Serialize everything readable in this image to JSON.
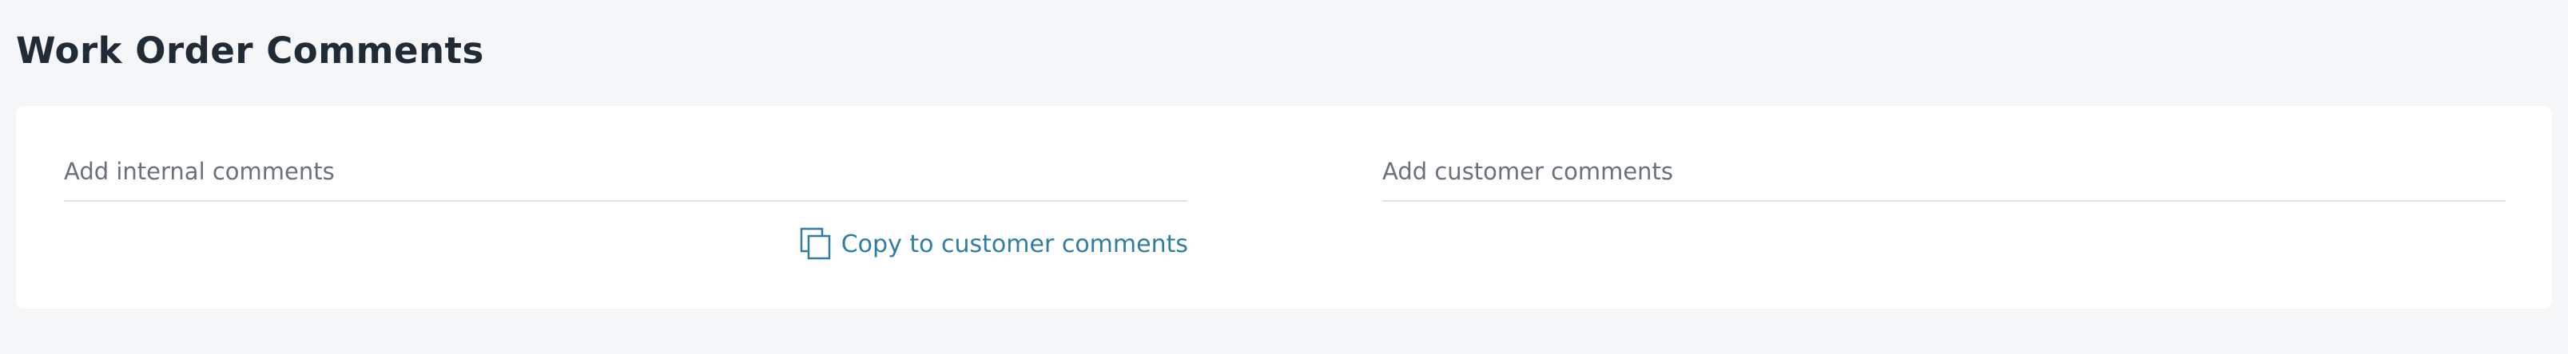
{
  "section": {
    "title": "Work Order Comments"
  },
  "internal_comments": {
    "placeholder": "Add internal comments",
    "value": ""
  },
  "customer_comments": {
    "placeholder": "Add customer comments",
    "value": ""
  },
  "copy_action": {
    "label": "Copy to customer comments",
    "icon": "copy-icon"
  },
  "colors": {
    "background": "#f4f6f8",
    "card": "#ffffff",
    "title": "#212b36",
    "placeholder": "#6b7178",
    "divider": "#dfe3e8",
    "link": "#2f7ea1"
  }
}
